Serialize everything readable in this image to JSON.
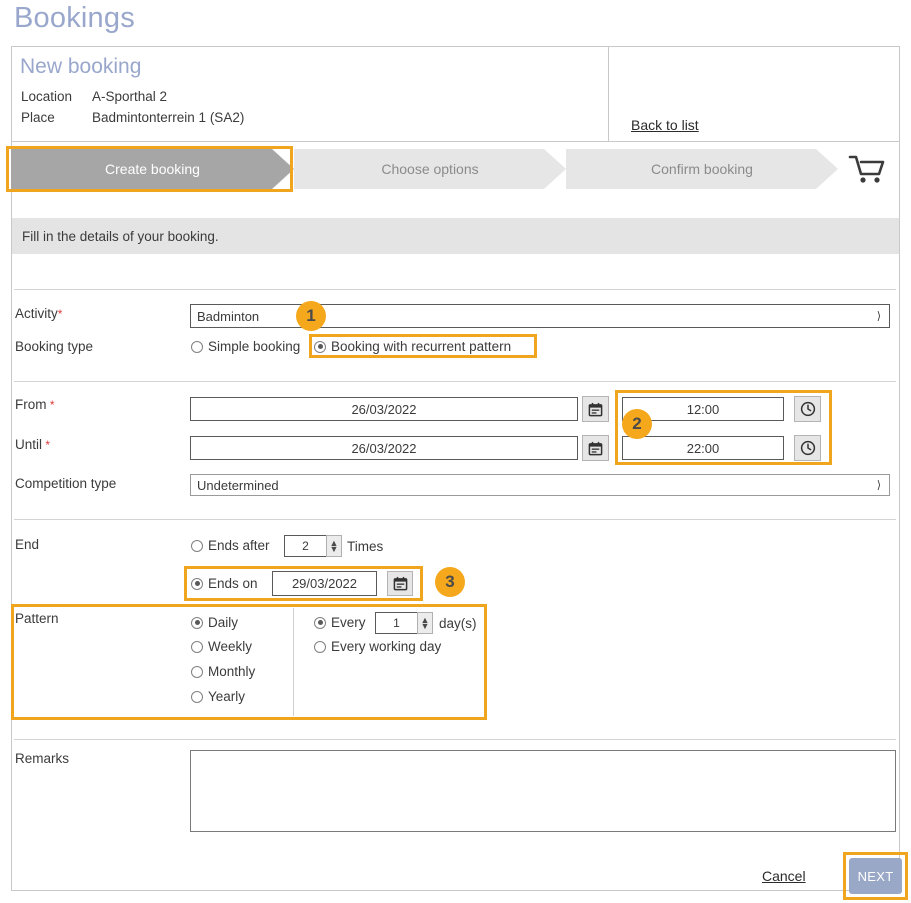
{
  "page": {
    "title": "Bookings"
  },
  "summary": {
    "heading": "New booking",
    "location_label": "Location",
    "location_value": "A-Sporthal 2",
    "place_label": "Place",
    "place_value": "Badmintonterrein 1 (SA2)",
    "back_link": "Back to list"
  },
  "wizard": {
    "steps": [
      {
        "label": "Create booking",
        "state": "active"
      },
      {
        "label": "Choose options",
        "state": "inactive"
      },
      {
        "label": "Confirm booking",
        "state": "inactive"
      }
    ],
    "cart_icon": "shopping-cart-icon"
  },
  "infobar": {
    "text": "Fill in the details of your booking."
  },
  "form": {
    "activity": {
      "label": "Activity",
      "required": "*",
      "value": "Badminton",
      "options": [
        "Badminton"
      ]
    },
    "booking_type": {
      "label": "Booking type",
      "options": [
        {
          "label": "Simple booking",
          "selected": false
        },
        {
          "label": "Booking with recurrent pattern",
          "selected": true
        }
      ]
    },
    "from": {
      "label": "From",
      "required": "*",
      "date": "26/03/2022",
      "time": "12:00"
    },
    "until": {
      "label": "Until",
      "required": "*",
      "date": "26/03/2022",
      "time": "22:00"
    },
    "competition_type": {
      "label": "Competition type",
      "value": "Undetermined",
      "options": [
        "Undetermined"
      ]
    },
    "end": {
      "label": "End",
      "ends_after_label": "Ends after",
      "ends_after_value": "2",
      "times_label": "Times",
      "ends_after_selected": false,
      "ends_on_label": "Ends on",
      "ends_on_value": "29/03/2022",
      "ends_on_selected": true
    },
    "pattern": {
      "label": "Pattern",
      "frequency": [
        {
          "label": "Daily",
          "selected": true
        },
        {
          "label": "Weekly",
          "selected": false
        },
        {
          "label": "Monthly",
          "selected": false
        },
        {
          "label": "Yearly",
          "selected": false
        }
      ],
      "every_label": "Every",
      "every_value": "1",
      "days_label": "day(s)",
      "every_selected": true,
      "working_day_label": "Every working day",
      "working_day_selected": false
    },
    "remarks": {
      "label": "Remarks",
      "value": ""
    }
  },
  "footer": {
    "cancel_label": "Cancel",
    "next_label": "NEXT"
  },
  "annotations": {
    "badge1": "1",
    "badge2": "2",
    "badge3": "3"
  },
  "colors": {
    "accent_orange": "#f5a81c",
    "title_blue": "#99a7cc",
    "step_active_gray": "#a6a6a6",
    "step_inactive_gray": "#e6e6e6",
    "next_button_blue": "#9aa8c8",
    "required_red": "#e03a3a"
  }
}
